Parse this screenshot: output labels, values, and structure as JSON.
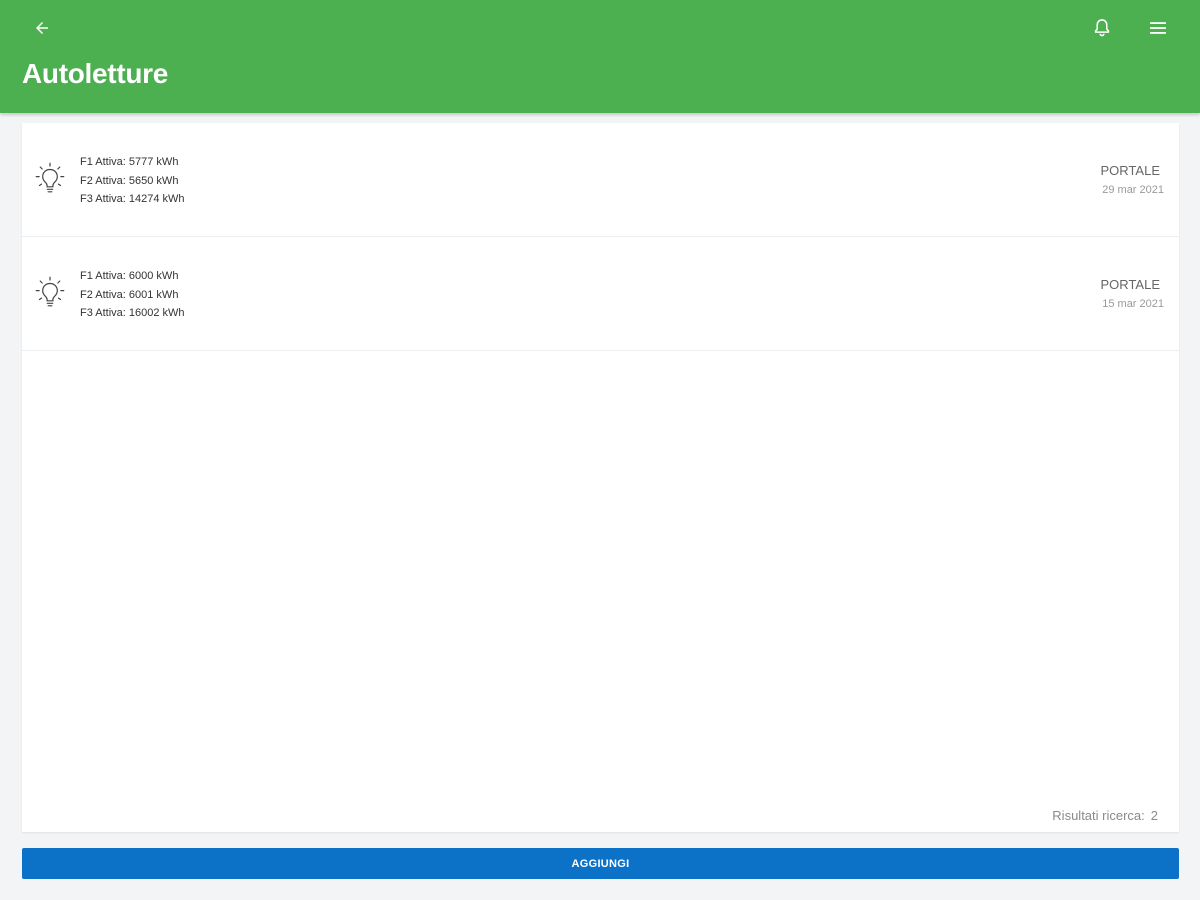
{
  "header": {
    "title": "Autoletture",
    "background_color": "#4caf50",
    "back_icon": "arrow-back-icon",
    "notification_icon": "bell-icon",
    "menu_icon": "hamburger-menu-icon"
  },
  "readings": [
    {
      "icon": "lightbulb-icon",
      "lines": [
        "F1 Attiva: 5777 kWh",
        "F2 Attiva: 5650 kWh",
        "F3 Attiva: 14274 kWh"
      ],
      "source": "PORTALE",
      "date": "29 mar 2021"
    },
    {
      "icon": "lightbulb-icon",
      "lines": [
        "F1 Attiva: 6000 kWh",
        "F2 Attiva: 6001 kWh",
        "F3 Attiva: 16002 kWh"
      ],
      "source": "PORTALE",
      "date": "15 mar 2021"
    }
  ],
  "footer": {
    "results_label": "Risultati ricerca:",
    "results_count": "2"
  },
  "add_button": {
    "label": "AGGIUNGI",
    "color": "#0b72c8"
  }
}
